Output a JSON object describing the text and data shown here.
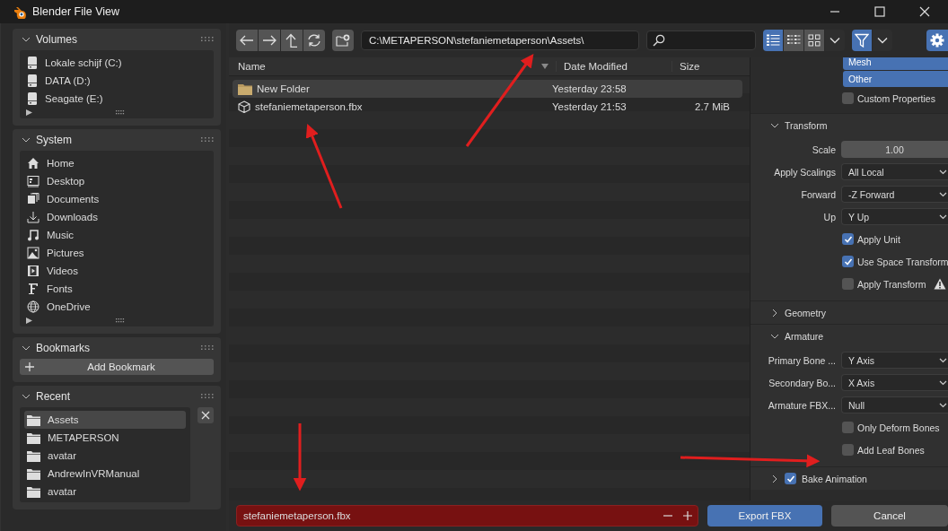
{
  "window": {
    "title": "Blender File View"
  },
  "sidebar": [
    {
      "kind": "volumes",
      "title": "Volumes",
      "expanded": true,
      "items": [
        {
          "label": "Lokale schijf (C:)"
        },
        {
          "label": "DATA (D:)"
        },
        {
          "label": "Seagate (E:)"
        }
      ]
    },
    {
      "kind": "system",
      "title": "System",
      "expanded": true,
      "items": [
        {
          "label": "Home"
        },
        {
          "label": "Desktop"
        },
        {
          "label": "Documents"
        },
        {
          "label": "Downloads"
        },
        {
          "label": "Music"
        },
        {
          "label": "Pictures"
        },
        {
          "label": "Videos"
        },
        {
          "label": "Fonts"
        },
        {
          "label": "OneDrive"
        }
      ]
    },
    {
      "kind": "bookmarks",
      "title": "Bookmarks",
      "expanded": true,
      "button": "Add Bookmark"
    },
    {
      "kind": "recent",
      "title": "Recent",
      "expanded": true,
      "items": [
        {
          "label": "Assets",
          "selected": true
        },
        {
          "label": "METAPERSON",
          "selected": false
        },
        {
          "label": "avatar",
          "selected": false
        },
        {
          "label": "AndrewInVRManual",
          "selected": false
        },
        {
          "label": "avatar",
          "selected": false
        }
      ]
    }
  ],
  "toolbar": {
    "path": "C:\\METAPERSON\\stefaniemetaperson\\Assets\\",
    "view_modes": [
      {
        "selected": true
      },
      {
        "selected": false
      },
      {
        "selected": false
      }
    ],
    "filter_on": true,
    "settings_on": true
  },
  "file_list": {
    "columns": [
      "Name",
      "Date Modified",
      "Size"
    ],
    "rows": [
      {
        "kind": "folder",
        "name": "New Folder",
        "date": "Yesterday 23:58",
        "selected": true
      },
      {
        "kind": "file",
        "name": "stefaniemetaperson.fbx",
        "date": "Yesterday 21:53",
        "size": "2.7 MiB",
        "selected": false
      }
    ]
  },
  "properties": {
    "object_types": [
      {
        "label": "Mesh",
        "selected": true
      },
      {
        "label": "Other",
        "selected": true
      }
    ],
    "custom_properties": {
      "label": "Custom Properties",
      "checked": false
    },
    "panels": [
      {
        "title": "Transform",
        "expanded": true,
        "rows": [
          {
            "kind": "number",
            "label": "Scale",
            "value": "1.00"
          },
          {
            "kind": "dropdown",
            "label": "Apply Scalings",
            "value": "All Local"
          },
          {
            "kind": "dropdown",
            "label": "Forward",
            "value": "-Z Forward"
          },
          {
            "kind": "dropdown",
            "label": "Up",
            "value": "Y Up"
          },
          {
            "kind": "checkbox",
            "label": "Apply Unit",
            "checked": true
          },
          {
            "kind": "checkbox",
            "label": "Use Space Transform",
            "checked": true
          },
          {
            "kind": "checkbox",
            "label": "Apply Transform",
            "checked": false,
            "warning": true
          }
        ]
      },
      {
        "title": "Geometry",
        "expanded": false
      },
      {
        "title": "Armature",
        "expanded": true,
        "rows": [
          {
            "kind": "dropdown",
            "label": "Primary Bone ...",
            "value": "Y Axis"
          },
          {
            "kind": "dropdown",
            "label": "Secondary Bo...",
            "value": "X Axis"
          },
          {
            "kind": "dropdown",
            "label": "Armature FBX...",
            "value": "Null"
          },
          {
            "kind": "checkbox",
            "label": "Only Deform Bones",
            "checked": false
          },
          {
            "kind": "checkbox",
            "label": "Add Leaf Bones",
            "checked": false
          }
        ]
      },
      {
        "title": "Bake Animation",
        "expanded": false,
        "checked": true
      }
    ]
  },
  "bottom": {
    "filename": "stefaniemetaperson.fbx",
    "file_exists": true,
    "buttons": [
      {
        "kind": "primary",
        "label": "Export FBX"
      },
      {
        "kind": "secondary",
        "label": "Cancel"
      }
    ]
  }
}
